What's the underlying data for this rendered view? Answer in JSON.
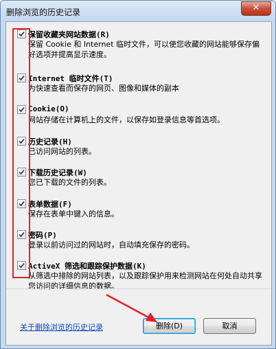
{
  "window": {
    "title": "删除浏览的历史记录",
    "close_glyph": "✕"
  },
  "items": [
    {
      "title": "保留收藏夹网站数据(R)",
      "desc": "保留 Cookie 和 Internet 临时文件，可以使您收藏的网站能够保存偏好选项并提高显示速度。",
      "checked": true
    },
    {
      "title": "Internet 临时文件(T)",
      "desc": "为快速查看而保存的网页、图像和媒体的副本",
      "checked": true
    },
    {
      "title": "Cookie(O)",
      "desc": "网站存储在计算机上的文件，以保存如登录信息等首选项。",
      "checked": true
    },
    {
      "title": "历史记录(H)",
      "desc": "已访问网站的列表。",
      "checked": true
    },
    {
      "title": "下载历史记录(W)",
      "desc": "您已下载的文件的列表。",
      "checked": true
    },
    {
      "title": "表单数据(F)",
      "desc": "保存在表单中键入的信息。",
      "checked": true
    },
    {
      "title": "密码(P)",
      "desc": "登录以前访问过的网站时，自动填充保存的密码。",
      "checked": true
    },
    {
      "title": "ActiveX 筛选和跟踪保护数据(K)",
      "desc": "从筛选中排除的网站列表，以及跟踪保护用来检测网站在何处自动共享您访问的详细信息的数据。",
      "checked": true
    }
  ],
  "footer": {
    "help_link": "关于删除浏览的历史记录",
    "delete_label": "删除(D)",
    "cancel_label": "取消"
  },
  "annotation_color": "#e5202a"
}
